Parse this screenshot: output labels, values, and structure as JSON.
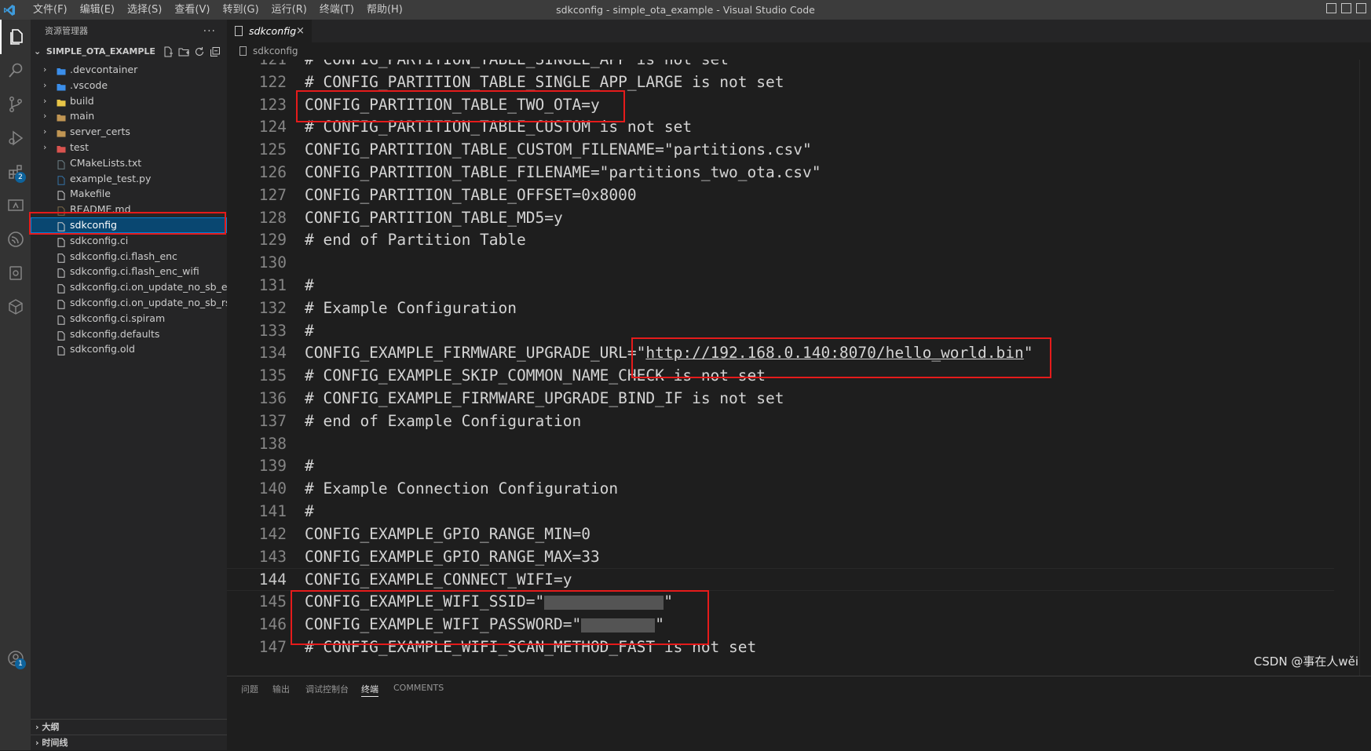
{
  "titlebar": {
    "window_title": "sdkconfig - simple_ota_example - Visual Studio Code",
    "menu": [
      "文件(F)",
      "编辑(E)",
      "选择(S)",
      "查看(V)",
      "转到(G)",
      "运行(R)",
      "终端(T)",
      "帮助(H)"
    ]
  },
  "activitybar": {
    "items": [
      "explorer-icon",
      "search-icon",
      "source-control-icon",
      "run-debug-icon",
      "extensions-icon",
      "remote-explorer-icon",
      "espressif-icon",
      "device-icon",
      "components-icon"
    ],
    "extensions_badge": "2",
    "accounts_badge": "1"
  },
  "sidebar": {
    "title": "资源管理器",
    "more": "···",
    "project": "SIMPLE_OTA_EXAMPLE",
    "files": [
      {
        "name": ".devcontainer",
        "type": "folder",
        "icon_color": "#3b8eea"
      },
      {
        "name": ".vscode",
        "type": "folder",
        "icon_color": "#3b8eea"
      },
      {
        "name": "build",
        "type": "folder",
        "icon_color": "#e8c547"
      },
      {
        "name": "main",
        "type": "folder",
        "icon_color": "#c09553"
      },
      {
        "name": "server_certs",
        "type": "folder",
        "icon_color": "#c09553"
      },
      {
        "name": "test",
        "type": "folder",
        "icon_color": "#d9534f"
      },
      {
        "name": "CMakeLists.txt",
        "type": "file",
        "icon_color": "#6d8086"
      },
      {
        "name": "example_test.py",
        "type": "file",
        "icon_color": "#3572a5"
      },
      {
        "name": "Makefile",
        "type": "file",
        "icon_color": "#cccccc"
      },
      {
        "name": "README.md",
        "type": "file",
        "icon_color": "#7a6a4a"
      },
      {
        "name": "sdkconfig",
        "type": "file",
        "icon_color": "#cccccc",
        "selected": true
      },
      {
        "name": "sdkconfig.ci",
        "type": "file",
        "icon_color": "#cccccc"
      },
      {
        "name": "sdkconfig.ci.flash_enc",
        "type": "file",
        "icon_color": "#cccccc"
      },
      {
        "name": "sdkconfig.ci.flash_enc_wifi",
        "type": "file",
        "icon_color": "#cccccc"
      },
      {
        "name": "sdkconfig.ci.on_update_no_sb_ecdsa",
        "type": "file",
        "icon_color": "#cccccc"
      },
      {
        "name": "sdkconfig.ci.on_update_no_sb_rsa",
        "type": "file",
        "icon_color": "#cccccc"
      },
      {
        "name": "sdkconfig.ci.spiram",
        "type": "file",
        "icon_color": "#cccccc"
      },
      {
        "name": "sdkconfig.defaults",
        "type": "file",
        "icon_color": "#cccccc"
      },
      {
        "name": "sdkconfig.old",
        "type": "file",
        "icon_color": "#cccccc"
      }
    ],
    "outline_label": "大纲",
    "timeline_label": "时间线"
  },
  "editor": {
    "tab_label": "sdkconfig",
    "tab_close": "×",
    "breadcrumb": "sdkconfig",
    "current_line": "144",
    "lines": [
      {
        "n": "121",
        "kind": "comment",
        "text": "# CONFIG_PARTITION_TABLE_SINGLE_APP is not set"
      },
      {
        "n": "122",
        "kind": "comment",
        "text": "# CONFIG_PARTITION_TABLE_SINGLE_APP_LARGE is not set"
      },
      {
        "n": "123",
        "kind": "code",
        "text": "CONFIG_PARTITION_TABLE_TWO_OTA=y"
      },
      {
        "n": "124",
        "kind": "comment",
        "text": "# CONFIG_PARTITION_TABLE_CUSTOM is not set"
      },
      {
        "n": "125",
        "kind": "code",
        "text": "CONFIG_PARTITION_TABLE_CUSTOM_FILENAME=\"partitions.csv\""
      },
      {
        "n": "126",
        "kind": "code",
        "text": "CONFIG_PARTITION_TABLE_FILENAME=\"partitions_two_ota.csv\""
      },
      {
        "n": "127",
        "kind": "code",
        "text": "CONFIG_PARTITION_TABLE_OFFSET=0x8000"
      },
      {
        "n": "128",
        "kind": "code",
        "text": "CONFIG_PARTITION_TABLE_MD5=y"
      },
      {
        "n": "129",
        "kind": "comment",
        "text": "# end of Partition Table"
      },
      {
        "n": "130",
        "kind": "code",
        "text": ""
      },
      {
        "n": "131",
        "kind": "comment",
        "text": "#"
      },
      {
        "n": "132",
        "kind": "comment",
        "text": "# Example Configuration"
      },
      {
        "n": "133",
        "kind": "comment",
        "text": "#"
      },
      {
        "n": "134",
        "kind": "url",
        "prefix": "CONFIG_EXAMPLE_FIRMWARE_UPGRADE_URL=\"",
        "url": "http://192.168.0.140:8070/hello_world.bin",
        "suffix": "\""
      },
      {
        "n": "135",
        "kind": "comment",
        "text": "# CONFIG_EXAMPLE_SKIP_COMMON_NAME_CHECK is not set"
      },
      {
        "n": "136",
        "kind": "comment",
        "text": "# CONFIG_EXAMPLE_FIRMWARE_UPGRADE_BIND_IF is not set"
      },
      {
        "n": "137",
        "kind": "comment",
        "text": "# end of Example Configuration"
      },
      {
        "n": "138",
        "kind": "code",
        "text": ""
      },
      {
        "n": "139",
        "kind": "comment",
        "text": "#"
      },
      {
        "n": "140",
        "kind": "comment",
        "text": "# Example Connection Configuration"
      },
      {
        "n": "141",
        "kind": "comment",
        "text": "#"
      },
      {
        "n": "142",
        "kind": "code",
        "text": "CONFIG_EXAMPLE_GPIO_RANGE_MIN=0"
      },
      {
        "n": "143",
        "kind": "code",
        "text": "CONFIG_EXAMPLE_GPIO_RANGE_MAX=33"
      },
      {
        "n": "144",
        "kind": "code",
        "text": "CONFIG_EXAMPLE_CONNECT_WIFI=y"
      },
      {
        "n": "145",
        "kind": "redacted",
        "prefix": "CONFIG_EXAMPLE_WIFI_SSID=\"",
        "suffix": "\""
      },
      {
        "n": "146",
        "kind": "redacted",
        "prefix": "CONFIG_EXAMPLE_WIFI_PASSWORD=\"",
        "suffix": "\""
      },
      {
        "n": "147",
        "kind": "comment",
        "text": "# CONFIG_EXAMPLE_WIFI_SCAN_METHOD_FAST is not set"
      }
    ]
  },
  "panel": {
    "tabs": [
      "问题",
      "输出",
      "调试控制台",
      "终端",
      "COMMENTS"
    ],
    "active_tab": "终端"
  },
  "watermark": "CSDN @事在人wěi",
  "colors": {
    "comment": "#6a9955",
    "text": "#d4d4d4",
    "annotation_box": "#e51b1b",
    "selection": "#094771"
  }
}
